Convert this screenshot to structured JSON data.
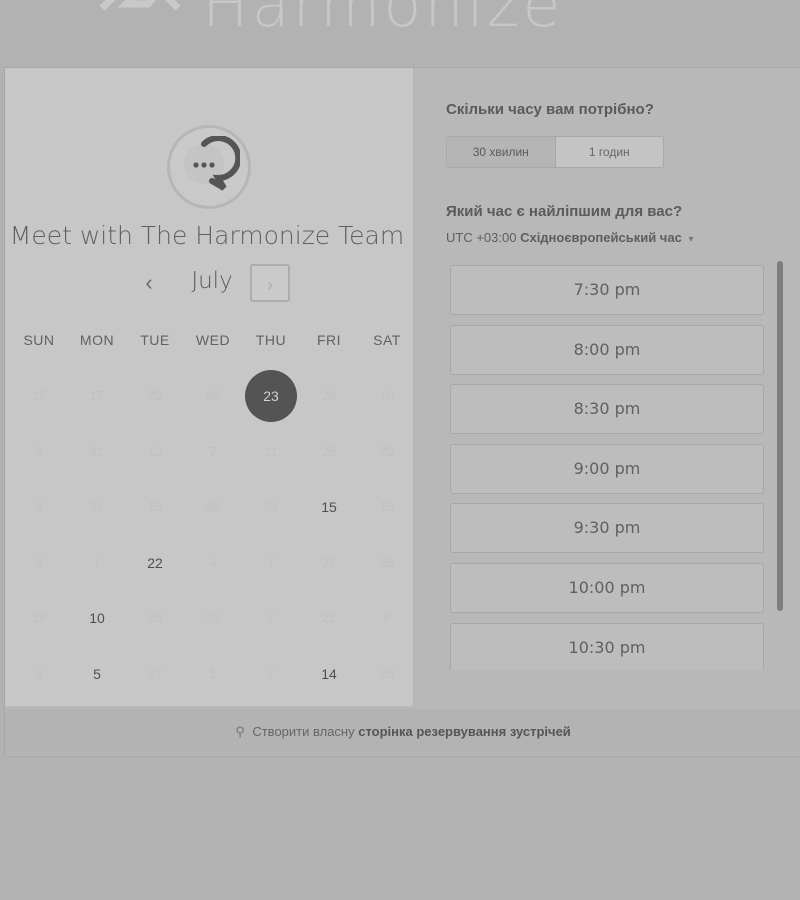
{
  "brand": {
    "name": "Harmonize"
  },
  "host": {
    "title": "Meet with The Harmonize Team"
  },
  "calendar": {
    "month": "July",
    "prev_icon": "‹",
    "next_icon": "›",
    "weekdays": [
      "SUN",
      "MON",
      "TUE",
      "WED",
      "THU",
      "FRI",
      "SAT"
    ],
    "weeks": [
      [
        {
          "d": "15",
          "s": "off"
        },
        {
          "d": "17",
          "s": "off"
        },
        {
          "d": "22",
          "s": "off"
        },
        {
          "d": "26",
          "s": "off"
        },
        {
          "d": "23",
          "s": "selected"
        },
        {
          "d": "28",
          "s": "off"
        },
        {
          "d": "10",
          "s": "off"
        }
      ],
      [
        {
          "d": "3",
          "s": "off"
        },
        {
          "d": "31",
          "s": "off"
        },
        {
          "d": "13",
          "s": "off"
        },
        {
          "d": "7",
          "s": "off"
        },
        {
          "d": "11",
          "s": "off"
        },
        {
          "d": "25",
          "s": "off"
        },
        {
          "d": "22",
          "s": "off"
        }
      ],
      [
        {
          "d": "8",
          "s": "off"
        },
        {
          "d": "31",
          "s": "off"
        },
        {
          "d": "15",
          "s": "off"
        },
        {
          "d": "25",
          "s": "off"
        },
        {
          "d": "24",
          "s": "off"
        },
        {
          "d": "15",
          "s": "available"
        },
        {
          "d": "18",
          "s": "off"
        }
      ],
      [
        {
          "d": "6",
          "s": "off"
        },
        {
          "d": "1",
          "s": "off"
        },
        {
          "d": "22",
          "s": "available"
        },
        {
          "d": "4",
          "s": "off"
        },
        {
          "d": "7",
          "s": "off"
        },
        {
          "d": "27",
          "s": "off"
        },
        {
          "d": "26",
          "s": "off"
        }
      ],
      [
        {
          "d": "16",
          "s": "off"
        },
        {
          "d": "10",
          "s": "available"
        },
        {
          "d": "28",
          "s": "off"
        },
        {
          "d": "28",
          "s": "off"
        },
        {
          "d": "7",
          "s": "off"
        },
        {
          "d": "22",
          "s": "off"
        },
        {
          "d": "6",
          "s": "off"
        }
      ],
      [
        {
          "d": "3",
          "s": "off"
        },
        {
          "d": "5",
          "s": "available"
        },
        {
          "d": "27",
          "s": "off"
        },
        {
          "d": "1",
          "s": "off"
        },
        {
          "d": "7",
          "s": "off"
        },
        {
          "d": "14",
          "s": "available"
        },
        {
          "d": "28",
          "s": "off"
        }
      ]
    ]
  },
  "duration": {
    "question": "Скільки часу вам потрібно?",
    "options": [
      "30 хвилин",
      "1 годин"
    ],
    "selected": "30 хвилин"
  },
  "time": {
    "question": "Який час є найліпшим для вас?",
    "timezone_offset": "UTC +03:00",
    "timezone_name": "Східноєвропейський час",
    "caret_icon": "▾",
    "slots": [
      "7:30 pm",
      "8:00 pm",
      "8:30 pm",
      "9:00 pm",
      "9:30 pm",
      "10:00 pm",
      "10:30 pm"
    ]
  },
  "footer": {
    "plug_icon": "⚲",
    "prefix": "Створити власну",
    "link": "сторінка резервування зустрічей"
  }
}
